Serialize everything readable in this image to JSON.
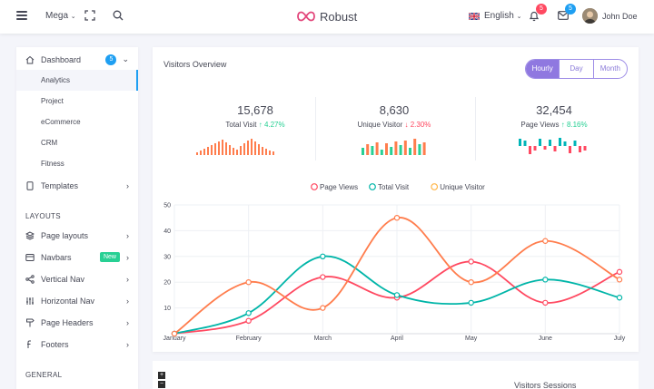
{
  "header": {
    "mega_label": "Mega",
    "brand": "Robust",
    "language": "English",
    "notification_count": "5",
    "mail_count": "5",
    "user_name": "John Doe"
  },
  "sidebar": {
    "dashboard": {
      "label": "Dashboard",
      "badge": "5"
    },
    "sub_items": [
      "Analytics",
      "Project",
      "eCommerce",
      "CRM",
      "Fitness"
    ],
    "templates": "Templates",
    "layouts_heading": "LAYOUTS",
    "layout_items": [
      {
        "label": "Page layouts",
        "icon": "layers-icon"
      },
      {
        "label": "Navbars",
        "icon": "navbar-icon",
        "badge": "New"
      },
      {
        "label": "Vertical Nav",
        "icon": "share-icon"
      },
      {
        "label": "Horizontal Nav",
        "icon": "sliders-icon"
      },
      {
        "label": "Page Headers",
        "icon": "signpost-icon"
      },
      {
        "label": "Footers",
        "icon": "footer-icon"
      }
    ],
    "general_heading": "GENERAL"
  },
  "visitors": {
    "title": "Visitors Overview",
    "tabs": [
      "Hourly",
      "Day",
      "Month"
    ],
    "active_tab": "Hourly",
    "stats": [
      {
        "value": "15,678",
        "label": "Total Visit",
        "change": "4.27%",
        "direction": "up",
        "color": "#ff7d4d"
      },
      {
        "value": "8,630",
        "label": "Unique Visitor",
        "change": "2.30%",
        "direction": "down",
        "color": "#28d094"
      },
      {
        "value": "32,454",
        "label": "Page Views",
        "change": "8.16%",
        "direction": "up",
        "color": "#00b5b8"
      }
    ]
  },
  "chart_data": {
    "type": "line",
    "categories": [
      "January",
      "February",
      "March",
      "April",
      "May",
      "June",
      "July"
    ],
    "ylim": [
      0,
      50
    ],
    "yticks": [
      10,
      20,
      30,
      40,
      50
    ],
    "grid": true,
    "legend_position": "top",
    "series": [
      {
        "name": "Page Views",
        "color": "#ff4961",
        "values": [
          0,
          5,
          22,
          14,
          28,
          12,
          24
        ]
      },
      {
        "name": "Total Visit",
        "color": "#00b5a8",
        "values": [
          0,
          8,
          30,
          15,
          12,
          21,
          14
        ]
      },
      {
        "name": "Unique Visitor",
        "color": "#ff7d4d",
        "values": [
          0,
          20,
          10,
          45,
          20,
          36,
          21
        ]
      }
    ],
    "legend_extra": {
      "name": "Unique Visitor",
      "color": "#ffb64a"
    }
  },
  "sessions": {
    "title": "Visitors Sessions",
    "zoom_in": "+",
    "zoom_out": "−"
  }
}
